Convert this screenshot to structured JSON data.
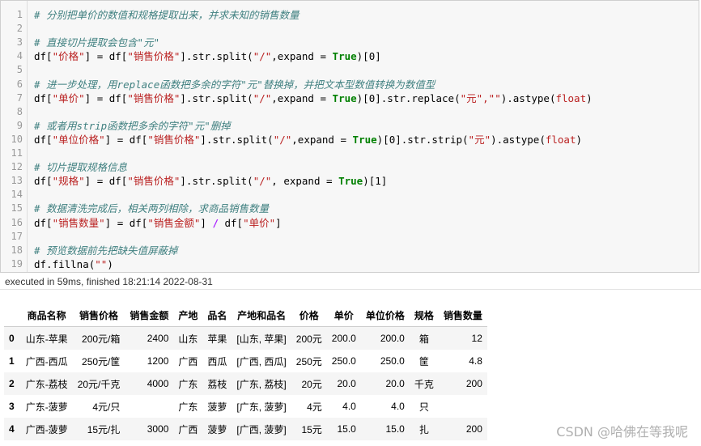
{
  "code_cell": {
    "lines": [
      {
        "n": "1",
        "parts": [
          {
            "t": "cm",
            "v": "# 分别把单价的数值和规格提取出来，并求未知的销售数量"
          }
        ]
      },
      {
        "n": "2",
        "parts": []
      },
      {
        "n": "3",
        "parts": [
          {
            "t": "cm",
            "v": "# 直接切片提取会包含\"元\""
          }
        ]
      },
      {
        "n": "4",
        "parts": [
          {
            "t": "p",
            "v": "df["
          },
          {
            "t": "str",
            "v": "\"价格\""
          },
          {
            "t": "p",
            "v": "] = df["
          },
          {
            "t": "str",
            "v": "\"销售价格\""
          },
          {
            "t": "p",
            "v": "].str.split("
          },
          {
            "t": "str",
            "v": "\"/\""
          },
          {
            "t": "p",
            "v": ",expand = "
          },
          {
            "t": "kw",
            "v": "True"
          },
          {
            "t": "p",
            "v": ")[0]"
          }
        ]
      },
      {
        "n": "5",
        "parts": []
      },
      {
        "n": "6",
        "parts": [
          {
            "t": "cm",
            "v": "# 进一步处理，用replace函数把多余的字符\"元\"替换掉，并把文本型数值转换为数值型"
          }
        ]
      },
      {
        "n": "7",
        "parts": [
          {
            "t": "p",
            "v": "df["
          },
          {
            "t": "str",
            "v": "\"单价\""
          },
          {
            "t": "p",
            "v": "] = df["
          },
          {
            "t": "str",
            "v": "\"销售价格\""
          },
          {
            "t": "p",
            "v": "].str.split("
          },
          {
            "t": "str",
            "v": "\"/\""
          },
          {
            "t": "p",
            "v": ",expand = "
          },
          {
            "t": "kw",
            "v": "True"
          },
          {
            "t": "p",
            "v": ")[0].str.replace("
          },
          {
            "t": "str",
            "v": "\"元\",\"\""
          },
          {
            "t": "p",
            "v": ").astype("
          },
          {
            "t": "str",
            "v": "float"
          },
          {
            "t": "p",
            "v": ")"
          }
        ]
      },
      {
        "n": "8",
        "parts": []
      },
      {
        "n": "9",
        "parts": [
          {
            "t": "cm",
            "v": "# 或者用strip函数把多余的字符\"元\"删掉"
          }
        ]
      },
      {
        "n": "10",
        "parts": [
          {
            "t": "p",
            "v": "df["
          },
          {
            "t": "str",
            "v": "\"单位价格\""
          },
          {
            "t": "p",
            "v": "] = df["
          },
          {
            "t": "str",
            "v": "\"销售价格\""
          },
          {
            "t": "p",
            "v": "].str.split("
          },
          {
            "t": "str",
            "v": "\"/\""
          },
          {
            "t": "p",
            "v": ",expand = "
          },
          {
            "t": "kw",
            "v": "True"
          },
          {
            "t": "p",
            "v": ")[0].str.strip("
          },
          {
            "t": "str",
            "v": "\"元\""
          },
          {
            "t": "p",
            "v": ").astype("
          },
          {
            "t": "str",
            "v": "float"
          },
          {
            "t": "p",
            "v": ")"
          }
        ]
      },
      {
        "n": "11",
        "parts": []
      },
      {
        "n": "12",
        "parts": [
          {
            "t": "cm",
            "v": "# 切片提取规格信息"
          }
        ]
      },
      {
        "n": "13",
        "parts": [
          {
            "t": "p",
            "v": "df["
          },
          {
            "t": "str",
            "v": "\"规格\""
          },
          {
            "t": "p",
            "v": "] = df["
          },
          {
            "t": "str",
            "v": "\"销售价格\""
          },
          {
            "t": "p",
            "v": "].str.split("
          },
          {
            "t": "str",
            "v": "\"/\""
          },
          {
            "t": "p",
            "v": ", expand = "
          },
          {
            "t": "kw",
            "v": "True"
          },
          {
            "t": "p",
            "v": ")[1]"
          }
        ]
      },
      {
        "n": "14",
        "parts": []
      },
      {
        "n": "15",
        "parts": [
          {
            "t": "cm",
            "v": "# 数据清洗完成后，相关两列相除，求商品销售数量"
          }
        ]
      },
      {
        "n": "16",
        "parts": [
          {
            "t": "p",
            "v": "df["
          },
          {
            "t": "str",
            "v": "\"销售数量\""
          },
          {
            "t": "p",
            "v": "] = df["
          },
          {
            "t": "str",
            "v": "\"销售金额\""
          },
          {
            "t": "p",
            "v": "] "
          },
          {
            "t": "op",
            "v": "/"
          },
          {
            "t": "p",
            "v": " df["
          },
          {
            "t": "str",
            "v": "\"单价\""
          },
          {
            "t": "p",
            "v": "]"
          }
        ]
      },
      {
        "n": "17",
        "parts": []
      },
      {
        "n": "18",
        "parts": [
          {
            "t": "cm",
            "v": "# 预览数据前先把缺失值屏蔽掉"
          }
        ]
      },
      {
        "n": "19",
        "parts": [
          {
            "t": "p",
            "v": "df.fillna("
          },
          {
            "t": "str",
            "v": "\"\""
          },
          {
            "t": "p",
            "v": ")"
          }
        ]
      }
    ]
  },
  "exec_status": "executed in 59ms, finished 18:21:14 2022-08-31",
  "dataframe": {
    "columns": [
      "",
      "商品名称",
      "销售价格",
      "销售金额",
      "产地",
      "品名",
      "产地和品名",
      "价格",
      "单价",
      "单位价格",
      "规格",
      "销售数量"
    ],
    "rows": [
      [
        "0",
        "山东-苹果",
        "200元/箱",
        "2400",
        "山东",
        "苹果",
        "[山东, 苹果]",
        "200元",
        "200.0",
        "200.0",
        "箱",
        "12"
      ],
      [
        "1",
        "广西-西瓜",
        "250元/筐",
        "1200",
        "广西",
        "西瓜",
        "[广西, 西瓜]",
        "250元",
        "250.0",
        "250.0",
        "筐",
        "4.8"
      ],
      [
        "2",
        "广东-荔枝",
        "20元/千克",
        "4000",
        "广东",
        "荔枝",
        "[广东, 荔枝]",
        "20元",
        "20.0",
        "20.0",
        "千克",
        "200"
      ],
      [
        "3",
        "广东-菠萝",
        "4元/只",
        "",
        "广东",
        "菠萝",
        "[广东, 菠萝]",
        "4元",
        "4.0",
        "4.0",
        "只",
        ""
      ],
      [
        "4",
        "广西-菠萝",
        "15元/扎",
        "3000",
        "广西",
        "菠萝",
        "[广西, 菠萝]",
        "15元",
        "15.0",
        "15.0",
        "扎",
        "200"
      ]
    ]
  },
  "watermark": "CSDN @哈佛在等我呢"
}
